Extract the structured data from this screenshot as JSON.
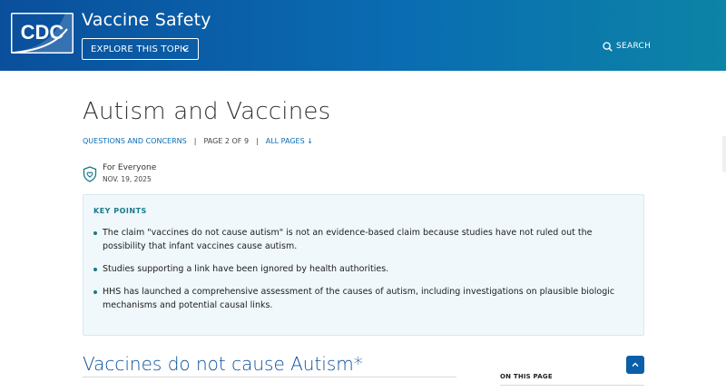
{
  "header": {
    "logo_text": "CDC",
    "site_title": "Vaccine Safety",
    "explore_label": "EXPLORE THIS TOPIC",
    "search_label": "SEARCH"
  },
  "page": {
    "title": "Autism and Vaccines",
    "breadcrumb_link": "QUESTIONS AND CONCERNS",
    "page_indicator": "PAGE 2 OF 9",
    "all_pages_label": "ALL PAGES ↓",
    "audience": "For Everyone",
    "date": "NOV. 19, 2025"
  },
  "key_points": {
    "title": "KEY POINTS",
    "items": [
      "The claim \"vaccines do not cause autism\" is not an evidence-based claim because studies have not ruled out the possibility that infant vaccines cause autism.",
      "Studies supporting a link have been ignored by health authorities.",
      "HHS has launched a comprehensive assessment of the causes of autism, including investigations on plausible biologic mechanisms and potential causal links."
    ]
  },
  "section": {
    "title": "Vaccines do not cause Autism*"
  },
  "sidebar": {
    "on_this_page": "ON THIS PAGE"
  },
  "icons": {
    "logo": "cdc-logo",
    "explore": "chevron-down-icon",
    "search": "search-icon",
    "audience": "shield-heart-icon",
    "to_top": "chevron-up-icon"
  },
  "colors": {
    "header_start": "#0a4f9c",
    "header_end": "#0c84a6",
    "link": "#0a6cb2",
    "accent_teal": "#1a7a8a",
    "key_box_bg": "#f0f8fc",
    "section_title": "#0a4f9c"
  }
}
